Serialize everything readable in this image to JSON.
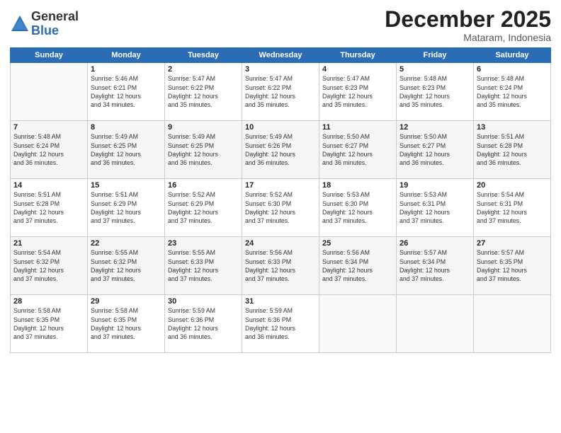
{
  "logo": {
    "general": "General",
    "blue": "Blue"
  },
  "header": {
    "month": "December 2025",
    "location": "Mataram, Indonesia"
  },
  "weekdays": [
    "Sunday",
    "Monday",
    "Tuesday",
    "Wednesday",
    "Thursday",
    "Friday",
    "Saturday"
  ],
  "weeks": [
    [
      {
        "day": "",
        "info": ""
      },
      {
        "day": "1",
        "info": "Sunrise: 5:46 AM\nSunset: 6:21 PM\nDaylight: 12 hours\nand 34 minutes."
      },
      {
        "day": "2",
        "info": "Sunrise: 5:47 AM\nSunset: 6:22 PM\nDaylight: 12 hours\nand 35 minutes."
      },
      {
        "day": "3",
        "info": "Sunrise: 5:47 AM\nSunset: 6:22 PM\nDaylight: 12 hours\nand 35 minutes."
      },
      {
        "day": "4",
        "info": "Sunrise: 5:47 AM\nSunset: 6:23 PM\nDaylight: 12 hours\nand 35 minutes."
      },
      {
        "day": "5",
        "info": "Sunrise: 5:48 AM\nSunset: 6:23 PM\nDaylight: 12 hours\nand 35 minutes."
      },
      {
        "day": "6",
        "info": "Sunrise: 5:48 AM\nSunset: 6:24 PM\nDaylight: 12 hours\nand 35 minutes."
      }
    ],
    [
      {
        "day": "7",
        "info": "Sunrise: 5:48 AM\nSunset: 6:24 PM\nDaylight: 12 hours\nand 36 minutes."
      },
      {
        "day": "8",
        "info": "Sunrise: 5:49 AM\nSunset: 6:25 PM\nDaylight: 12 hours\nand 36 minutes."
      },
      {
        "day": "9",
        "info": "Sunrise: 5:49 AM\nSunset: 6:25 PM\nDaylight: 12 hours\nand 36 minutes."
      },
      {
        "day": "10",
        "info": "Sunrise: 5:49 AM\nSunset: 6:26 PM\nDaylight: 12 hours\nand 36 minutes."
      },
      {
        "day": "11",
        "info": "Sunrise: 5:50 AM\nSunset: 6:27 PM\nDaylight: 12 hours\nand 36 minutes."
      },
      {
        "day": "12",
        "info": "Sunrise: 5:50 AM\nSunset: 6:27 PM\nDaylight: 12 hours\nand 36 minutes."
      },
      {
        "day": "13",
        "info": "Sunrise: 5:51 AM\nSunset: 6:28 PM\nDaylight: 12 hours\nand 36 minutes."
      }
    ],
    [
      {
        "day": "14",
        "info": "Sunrise: 5:51 AM\nSunset: 6:28 PM\nDaylight: 12 hours\nand 37 minutes."
      },
      {
        "day": "15",
        "info": "Sunrise: 5:51 AM\nSunset: 6:29 PM\nDaylight: 12 hours\nand 37 minutes."
      },
      {
        "day": "16",
        "info": "Sunrise: 5:52 AM\nSunset: 6:29 PM\nDaylight: 12 hours\nand 37 minutes."
      },
      {
        "day": "17",
        "info": "Sunrise: 5:52 AM\nSunset: 6:30 PM\nDaylight: 12 hours\nand 37 minutes."
      },
      {
        "day": "18",
        "info": "Sunrise: 5:53 AM\nSunset: 6:30 PM\nDaylight: 12 hours\nand 37 minutes."
      },
      {
        "day": "19",
        "info": "Sunrise: 5:53 AM\nSunset: 6:31 PM\nDaylight: 12 hours\nand 37 minutes."
      },
      {
        "day": "20",
        "info": "Sunrise: 5:54 AM\nSunset: 6:31 PM\nDaylight: 12 hours\nand 37 minutes."
      }
    ],
    [
      {
        "day": "21",
        "info": "Sunrise: 5:54 AM\nSunset: 6:32 PM\nDaylight: 12 hours\nand 37 minutes."
      },
      {
        "day": "22",
        "info": "Sunrise: 5:55 AM\nSunset: 6:32 PM\nDaylight: 12 hours\nand 37 minutes."
      },
      {
        "day": "23",
        "info": "Sunrise: 5:55 AM\nSunset: 6:33 PM\nDaylight: 12 hours\nand 37 minutes."
      },
      {
        "day": "24",
        "info": "Sunrise: 5:56 AM\nSunset: 6:33 PM\nDaylight: 12 hours\nand 37 minutes."
      },
      {
        "day": "25",
        "info": "Sunrise: 5:56 AM\nSunset: 6:34 PM\nDaylight: 12 hours\nand 37 minutes."
      },
      {
        "day": "26",
        "info": "Sunrise: 5:57 AM\nSunset: 6:34 PM\nDaylight: 12 hours\nand 37 minutes."
      },
      {
        "day": "27",
        "info": "Sunrise: 5:57 AM\nSunset: 6:35 PM\nDaylight: 12 hours\nand 37 minutes."
      }
    ],
    [
      {
        "day": "28",
        "info": "Sunrise: 5:58 AM\nSunset: 6:35 PM\nDaylight: 12 hours\nand 37 minutes."
      },
      {
        "day": "29",
        "info": "Sunrise: 5:58 AM\nSunset: 6:35 PM\nDaylight: 12 hours\nand 37 minutes."
      },
      {
        "day": "30",
        "info": "Sunrise: 5:59 AM\nSunset: 6:36 PM\nDaylight: 12 hours\nand 36 minutes."
      },
      {
        "day": "31",
        "info": "Sunrise: 5:59 AM\nSunset: 6:36 PM\nDaylight: 12 hours\nand 36 minutes."
      },
      {
        "day": "",
        "info": ""
      },
      {
        "day": "",
        "info": ""
      },
      {
        "day": "",
        "info": ""
      }
    ]
  ]
}
